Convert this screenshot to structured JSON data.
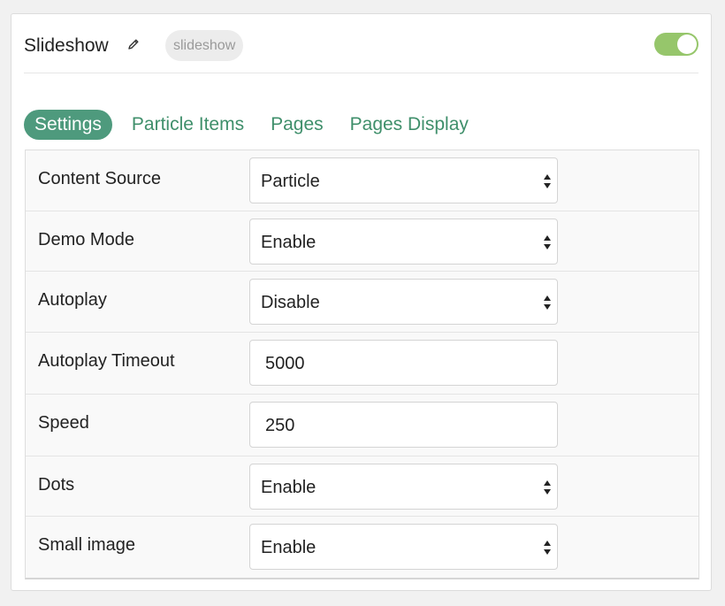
{
  "header": {
    "title": "Slideshow",
    "badge": "slideshow",
    "enabled": true
  },
  "tabs": [
    {
      "label": "Settings",
      "active": true
    },
    {
      "label": "Particle Items",
      "active": false
    },
    {
      "label": "Pages",
      "active": false
    },
    {
      "label": "Pages Display",
      "active": false
    }
  ],
  "fields": [
    {
      "label": "Content Source",
      "type": "select",
      "value": "Particle"
    },
    {
      "label": "Demo Mode",
      "type": "select",
      "value": "Enable"
    },
    {
      "label": "Autoplay",
      "type": "select",
      "value": "Disable"
    },
    {
      "label": "Autoplay Timeout",
      "type": "input",
      "value": "5000"
    },
    {
      "label": "Speed",
      "type": "input",
      "value": "250"
    },
    {
      "label": "Dots",
      "type": "select",
      "value": "Enable"
    },
    {
      "label": "Small image",
      "type": "select",
      "value": "Enable"
    }
  ],
  "colors": {
    "accent": "#4e9a7d",
    "toggle_on": "#96c66b"
  }
}
